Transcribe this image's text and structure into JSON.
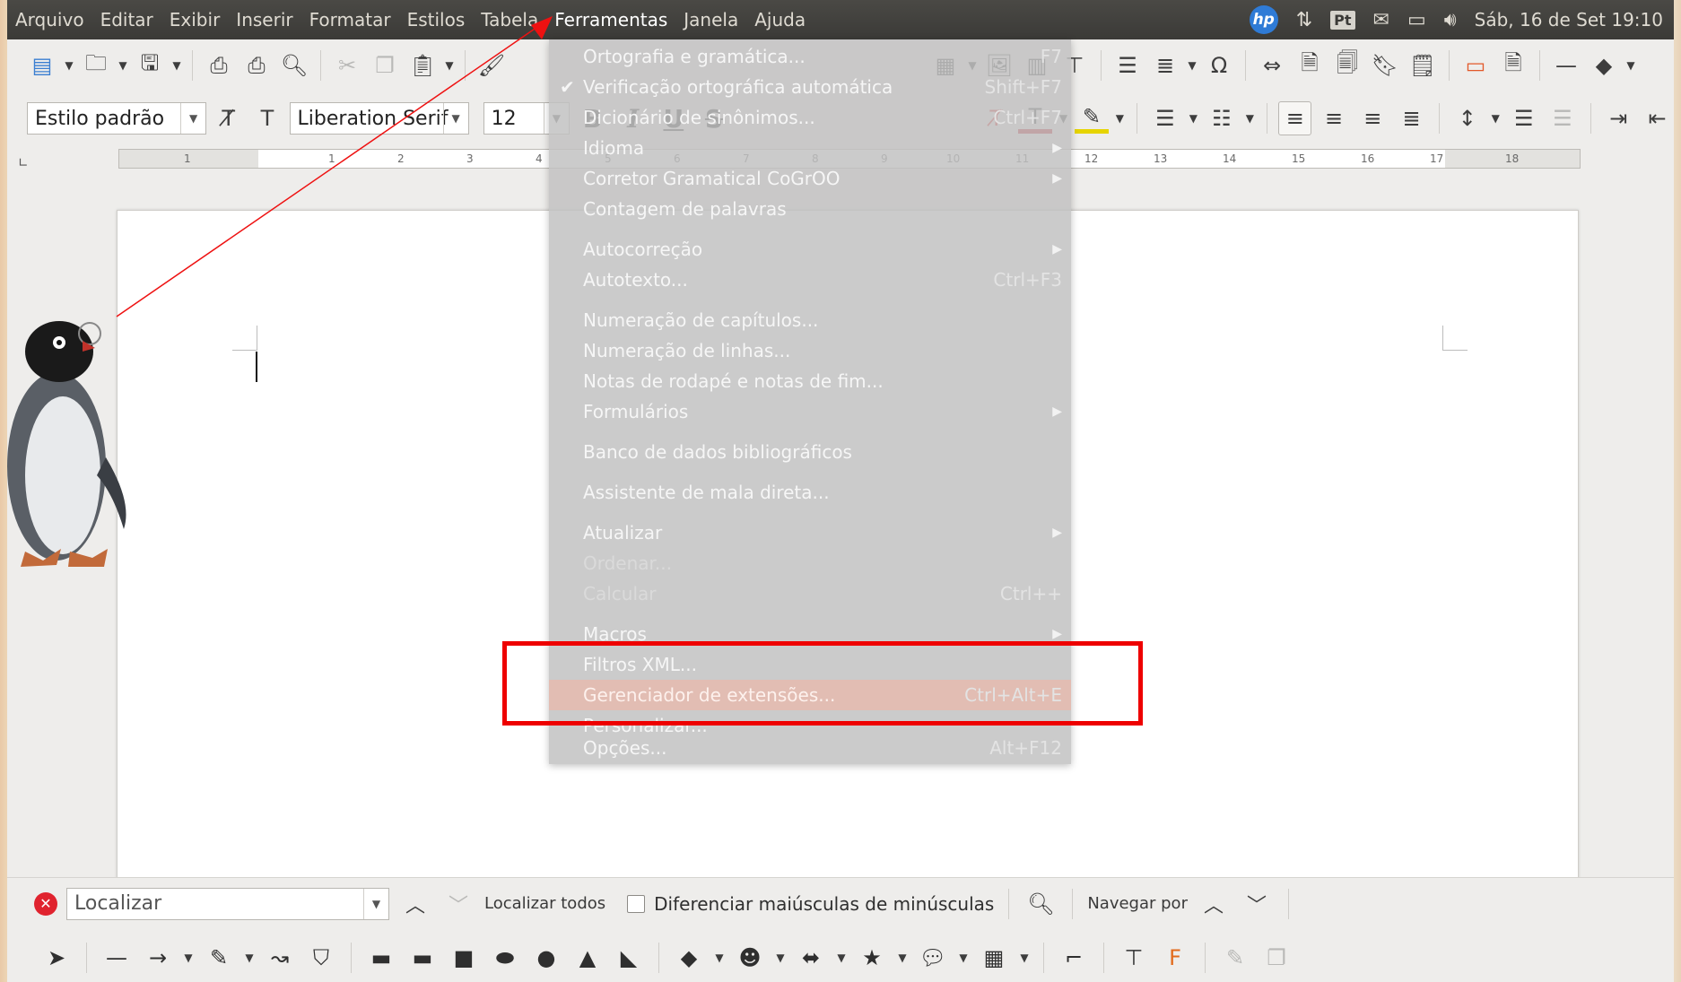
{
  "menubar": {
    "items": [
      "Arquivo",
      "Editar",
      "Exibir",
      "Inserir",
      "Formatar",
      "Estilos",
      "Tabela",
      "Ferramentas",
      "Janela",
      "Ajuda"
    ],
    "active_index": 7
  },
  "tray": {
    "hp_label": "hp",
    "lang_badge": "Pt",
    "clock": "Sáb, 16 de Set 19:10"
  },
  "format_toolbar": {
    "paragraph_style": "Estilo padrão",
    "font_name": "Liberation Serif",
    "font_size": "12",
    "bold": "B",
    "italic": "I",
    "underline": "U",
    "strikethrough": "S"
  },
  "ruler": {
    "ticks": [
      "1",
      "1",
      "2",
      "3",
      "4",
      "5",
      "6",
      "7",
      "8",
      "9",
      "10",
      "11",
      "12",
      "13",
      "14",
      "15",
      "16",
      "17",
      "18"
    ]
  },
  "tools_menu": {
    "items": [
      {
        "label": "Ortografia e gramática...",
        "shortcut": "F7"
      },
      {
        "label": "Verificação ortográfica automática",
        "shortcut": "Shift+F7",
        "checked": true
      },
      {
        "label": "Dicionário de sinônimos...",
        "shortcut": "Ctrl+F7"
      },
      {
        "label": "Idioma",
        "submenu": true
      },
      {
        "label": "Corretor Gramatical CoGrOO",
        "submenu": true
      },
      {
        "label": "Contagem de palavras"
      },
      {
        "label": "Autocorreção",
        "submenu": true
      },
      {
        "label": "Autotexto...",
        "shortcut": "Ctrl+F3"
      },
      {
        "label": "Numeração de capítulos..."
      },
      {
        "label": "Numeração de linhas..."
      },
      {
        "label": "Notas de rodapé e notas de fim..."
      },
      {
        "label": "Formulários",
        "submenu": true
      },
      {
        "label": "Banco de dados bibliográficos"
      },
      {
        "label": "Assistente de mala direta..."
      },
      {
        "label": "Atualizar",
        "submenu": true
      },
      {
        "label": "Ordenar...",
        "disabled": true
      },
      {
        "label": "Calcular",
        "shortcut": "Ctrl++",
        "disabled": true
      },
      {
        "label": "Macros",
        "submenu": true
      },
      {
        "label": "Filtros XML..."
      },
      {
        "label": "Gerenciador de extensões...",
        "shortcut": "Ctrl+Alt+E",
        "highlighted": true
      },
      {
        "label": "Personalizar..."
      },
      {
        "label": "Opções...",
        "shortcut": "Alt+F12"
      }
    ]
  },
  "findbar": {
    "search_placeholder": "Localizar",
    "find_all": "Localizar todos",
    "match_case": "Diferenciar maiúsculas de minúsculas",
    "navigate_by": "Navegar por"
  },
  "colors": {
    "highlight_box": "#ee0000",
    "font_color_bar": "#c0181f",
    "highlight_color_bar": "#e6d400"
  }
}
